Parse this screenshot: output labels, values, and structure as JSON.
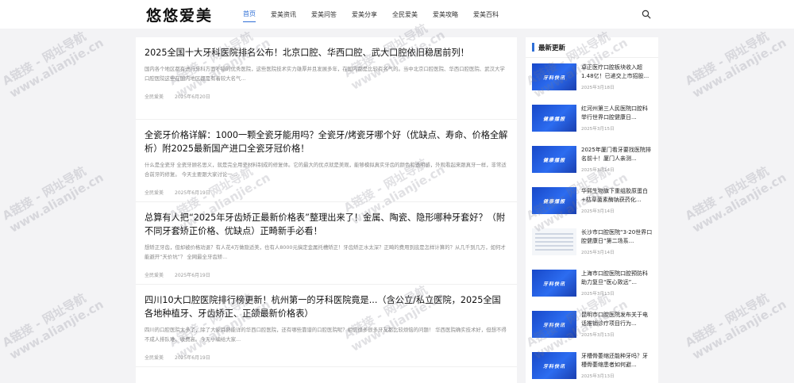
{
  "site": {
    "logo": "悠悠爱美"
  },
  "nav": {
    "items": [
      {
        "label": "首页",
        "active": true
      },
      {
        "label": "爱美资讯",
        "active": false
      },
      {
        "label": "爱美问答",
        "active": false
      },
      {
        "label": "爱美分享",
        "active": false
      },
      {
        "label": "全民爱美",
        "active": false
      },
      {
        "label": "爱美攻略",
        "active": false
      },
      {
        "label": "爱美百科",
        "active": false
      }
    ],
    "search_icon": "search-icon"
  },
  "articles": [
    {
      "title": "2025全国十大牙科医院排名公布！北京口腔、华西口腔、武大口腔依旧稳居前列！",
      "excerpt": "国内各个地区都有进行牙科方面不错的优秀医院，这些医院技术实力雄厚并且发展多年，在国内都是比较有名气的。当中北京口腔医院、华西口腔医院、武汉大学口腔医院这些在国内地区都是有着较大名气...",
      "author": "全民爱美",
      "date": "2025年6月20日"
    },
    {
      "title": "全瓷牙价格详解：1000一颗全瓷牙能用吗？全瓷牙/烤瓷牙哪个好（优缺点、寿命、价格全解析）附2025最新国产进口全瓷牙冠价格！",
      "excerpt": "什么是全瓷牙 全瓷牙顾名思义，就是完全用瓷材料制成的修复体。它的最大的优点就是美观，能够模拟真实牙齿的颜色和透明感，外观看起来跟真牙一样，非常适合前牙的修复。 今天主要跟大家讨论一...",
      "author": "全民爱美",
      "date": "2025年6月19日"
    },
    {
      "title": "总算有人把“2025年牙齿矫正最新价格表”整理出来了！金属、陶瓷、隐形哪种牙套好？（附不同牙套矫正价格、优缺点）正畸新手必看！",
      "excerpt": "想矫正牙齿，但却被价格劝退？有人花4万做隐适美，也有人8000元搞定金属托槽矫正！牙齿矫正水太深？正畸的费用到底是怎样计算的？从几千到几万，如何才能避开“天价坑”？ 全网最全牙齿矫...",
      "author": "全民爱美",
      "date": "2025年6月19日"
    },
    {
      "title": "四川10大口腔医院排行榜更新！杭州第一的牙科医院竟是...（含公立/私立医院，2025全国各地种植牙、牙齿矫正、正颌最新价格表）",
      "excerpt": "四川的口腔医院太多了，除了大家耳熟能详的华西口腔医院，还有哪些靠谱的口腔医院呢？相信很多很多牙友都比较烦恼的问题！ 华西医院确实技术好，但想不得不成人排队难、收费高。今天小编给大家...",
      "author": "全民爱美",
      "date": "2025年6月19日"
    }
  ],
  "sidebar": {
    "heading": "最新更新",
    "items": [
      {
        "thumb_text": "牙科快讯",
        "thumb_style": "blue",
        "title": "卓正医疗口腔板块收入超1.48亿！已递交上市招股...",
        "date": "2025年3月18日"
      },
      {
        "thumb_text": "健康播报",
        "thumb_style": "blue",
        "title": "红河州第三人民医院口腔科举行世界口腔健康日...",
        "date": "2025年3月15日"
      },
      {
        "thumb_text": "健康播报",
        "thumb_style": "blue",
        "title": "2025年厦门看牙要找医院排名前十！厦门人亲测...",
        "date": "2025年3月14日"
      },
      {
        "thumb_text": "健康播报",
        "thumb_style": "blue",
        "title": "华熙生物旗下重组胶原蛋白+枯草菌素酶钠获药化...",
        "date": "2025年3月14日"
      },
      {
        "thumb_text": "",
        "thumb_style": "light",
        "title": "长沙市口腔医院“3·20世界口腔健康日”第二场系...",
        "date": "2025年3月14日"
      },
      {
        "thumb_text": "牙科快讯",
        "thumb_style": "blue",
        "title": "上海市口腔医院口腔预防科助力复旦“医心致远”...",
        "date": "2025年3月13日"
      },
      {
        "thumb_text": "牙科快讯",
        "thumb_style": "blue",
        "title": "昆明市口腔医院发布关于电话推销诊疗项目行为...",
        "date": "2025年3月13日"
      },
      {
        "thumb_text": "牙科快讯",
        "thumb_style": "blue",
        "title": "牙槽骨萎缩还能种牙吗？牙槽骨萎缩患者如何避...",
        "date": "2025年3月13日"
      }
    ]
  },
  "watermark": {
    "line1": "A链接 - 网址导航",
    "line2": "www.alianjie.cn"
  }
}
